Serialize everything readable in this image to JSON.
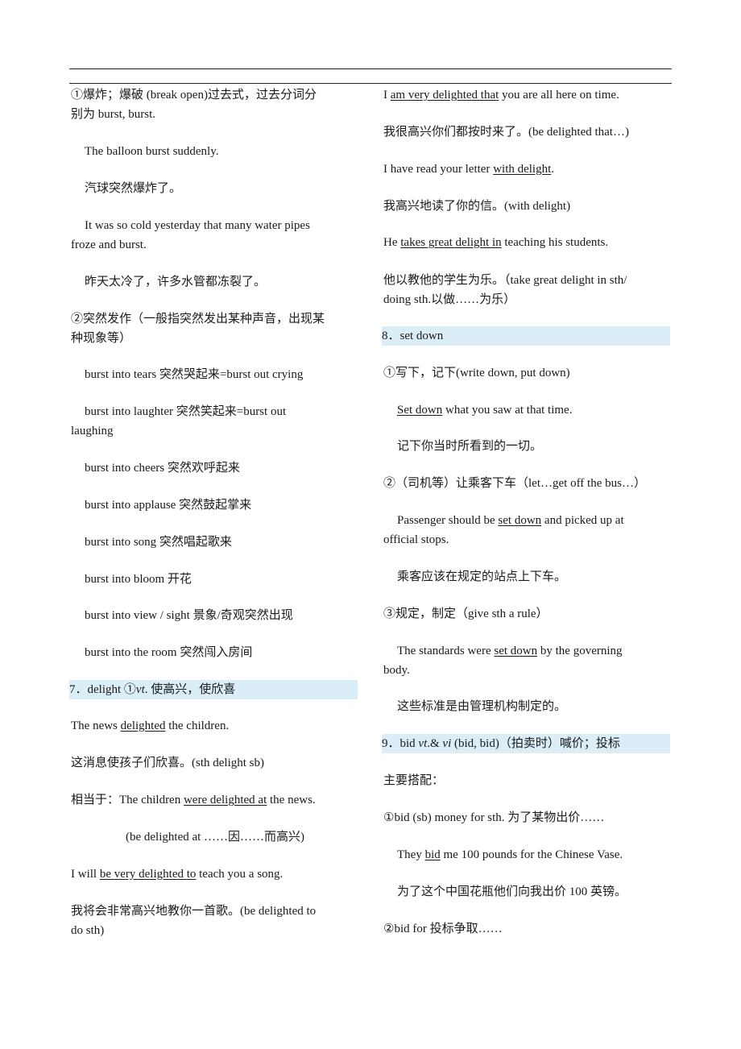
{
  "left_column": [
    {
      "style": "",
      "lines": [
        [
          {
            "t": "①爆炸；爆破  (break open)过去式，过去分词分"
          }
        ],
        [
          {
            "t": "别为  burst, burst."
          }
        ]
      ]
    },
    {
      "style": "indent",
      "lines": [
        [
          {
            "t": "The balloon burst suddenly."
          }
        ]
      ]
    },
    {
      "style": "indent",
      "lines": [
        [
          {
            "t": "汽球突然爆炸了。"
          }
        ]
      ]
    },
    {
      "style": "indent",
      "lines": [
        [
          {
            "t": "It was so cold yesterday that many water pipes"
          }
        ],
        [
          {
            "t": "froze and burst."
          }
        ]
      ]
    },
    {
      "style": "indent",
      "lines": [
        [
          {
            "t": "昨天太冷了，许多水管都冻裂了。"
          }
        ]
      ]
    },
    {
      "style": "",
      "lines": [
        [
          {
            "t": "②突然发作（一般指突然发出某种声音，出现某"
          }
        ],
        [
          {
            "t": "种现象等）"
          }
        ]
      ]
    },
    {
      "style": "indent",
      "lines": [
        [
          {
            "t": "burst into tears    突然哭起来=burst out crying"
          }
        ]
      ]
    },
    {
      "style": "indent",
      "lines": [
        [
          {
            "t": "burst into laughter    突然笑起来=burst out"
          }
        ],
        [
          {
            "t": "laughing"
          }
        ]
      ]
    },
    {
      "style": "indent",
      "lines": [
        [
          {
            "t": "burst into cheers    突然欢呼起来"
          }
        ]
      ]
    },
    {
      "style": "indent",
      "lines": [
        [
          {
            "t": "burst into applause    突然鼓起掌来"
          }
        ]
      ]
    },
    {
      "style": "indent",
      "lines": [
        [
          {
            "t": "burst into song    突然唱起歌来"
          }
        ]
      ]
    },
    {
      "style": "indent",
      "lines": [
        [
          {
            "t": "burst into bloom  开花"
          }
        ]
      ]
    },
    {
      "style": "indent",
      "lines": [
        [
          {
            "t": "burst into view / sight    景象/奇观突然出现"
          }
        ]
      ]
    },
    {
      "style": "indent",
      "lines": [
        [
          {
            "t": "burst into the room    突然闯入房间"
          }
        ]
      ]
    },
    {
      "style": "head",
      "lines": [
        [
          {
            "t": "7．delight  ①"
          },
          {
            "t": "vt",
            "s": "i"
          },
          {
            "t": ".  使高兴，使欣喜"
          }
        ]
      ]
    },
    {
      "style": "",
      "lines": [
        [
          {
            "t": "The news "
          },
          {
            "t": "delighted",
            "s": "u"
          },
          {
            "t": " the children."
          }
        ]
      ]
    },
    {
      "style": "",
      "lines": [
        [
          {
            "t": "这消息使孩子们欣喜。(sth delight sb)"
          }
        ]
      ]
    },
    {
      "style": "",
      "lines": [
        [
          {
            "t": "相当于：The children "
          },
          {
            "t": "were delighted at",
            "s": "u"
          },
          {
            "t": " the news."
          }
        ]
      ]
    },
    {
      "style": "deep",
      "lines": [
        [
          {
            "t": "(be delighted at ……因……而高兴)"
          }
        ]
      ]
    },
    {
      "style": "",
      "lines": [
        [
          {
            "t": "I will "
          },
          {
            "t": "be very delighted to",
            "s": "u"
          },
          {
            "t": " teach you a song."
          }
        ]
      ]
    },
    {
      "style": "",
      "lines": [
        [
          {
            "t": "我将会非常高兴地教你一首歌。(be delighted to"
          }
        ],
        [
          {
            "t": "do sth)"
          }
        ]
      ]
    }
  ],
  "right_column": [
    {
      "style": "",
      "lines": [
        [
          {
            "t": "I "
          },
          {
            "t": "am very delighted that",
            "s": "u"
          },
          {
            "t": " you are all here on time."
          }
        ]
      ]
    },
    {
      "style": "",
      "lines": [
        [
          {
            "t": "我很高兴你们都按时来了。(be delighted that…)"
          }
        ]
      ]
    },
    {
      "style": "",
      "lines": [
        [
          {
            "t": "I have read your letter "
          },
          {
            "t": "with delight",
            "s": "u"
          },
          {
            "t": "."
          }
        ]
      ]
    },
    {
      "style": "",
      "lines": [
        [
          {
            "t": "我高兴地读了你的信。(with delight)"
          }
        ]
      ]
    },
    {
      "style": "",
      "lines": [
        [
          {
            "t": "He "
          },
          {
            "t": "takes great delight in",
            "s": "u"
          },
          {
            "t": " teaching his students."
          }
        ]
      ]
    },
    {
      "style": "",
      "lines": [
        [
          {
            "t": "他以教他的学生为乐。（take great delight in sth/"
          }
        ],
        [
          {
            "t": "doing sth.以做……为乐）"
          }
        ]
      ]
    },
    {
      "style": "head",
      "lines": [
        [
          {
            "t": "8．set down"
          }
        ]
      ]
    },
    {
      "style": "",
      "lines": [
        [
          {
            "t": "①写下，记下(write down, put down)"
          }
        ]
      ]
    },
    {
      "style": "indent",
      "lines": [
        [
          {
            "t": "Set down",
            "s": "u"
          },
          {
            "t": " what you saw at that time."
          }
        ]
      ]
    },
    {
      "style": "indent",
      "lines": [
        [
          {
            "t": "记下你当时所看到的一切。"
          }
        ]
      ]
    },
    {
      "style": "",
      "lines": [
        [
          {
            "t": "②（司机等）让乘客下车（let…get off the bus…）"
          }
        ]
      ]
    },
    {
      "style": "indent",
      "lines": [
        [
          {
            "t": "Passenger should be "
          },
          {
            "t": "set down",
            "s": "u"
          },
          {
            "t": " and picked up at"
          }
        ],
        [
          {
            "t": "official stops."
          }
        ]
      ]
    },
    {
      "style": "indent",
      "lines": [
        [
          {
            "t": "乘客应该在规定的站点上下车。"
          }
        ]
      ]
    },
    {
      "style": "",
      "lines": [
        [
          {
            "t": "③规定，制定（give sth a rule）"
          }
        ]
      ]
    },
    {
      "style": "indent",
      "lines": [
        [
          {
            "t": "The standards were "
          },
          {
            "t": "set down",
            "s": "u"
          },
          {
            "t": " by the governing"
          }
        ],
        [
          {
            "t": "body."
          }
        ]
      ]
    },
    {
      "style": "indent",
      "lines": [
        [
          {
            "t": "这些标准是由管理机构制定的。"
          }
        ]
      ]
    },
    {
      "style": "head",
      "lines": [
        [
          {
            "t": "9．bid "
          },
          {
            "t": "vt",
            "s": "i"
          },
          {
            "t": ".& "
          },
          {
            "t": "vi",
            "s": "i"
          },
          {
            "t": " (bid, bid)（拍卖时）喊价；投标"
          }
        ]
      ]
    },
    {
      "style": "",
      "lines": [
        [
          {
            "t": "主要搭配："
          }
        ]
      ]
    },
    {
      "style": "",
      "lines": [
        [
          {
            "t": "①bid (sb) money for sth.  为了某物出价……"
          }
        ]
      ]
    },
    {
      "style": "indent",
      "lines": [
        [
          {
            "t": "They "
          },
          {
            "t": "bid",
            "s": "u"
          },
          {
            "t": " me 100 pounds for the Chinese Vase."
          }
        ]
      ]
    },
    {
      "style": "indent",
      "lines": [
        [
          {
            "t": "为了这个中国花瓶他们向我出价 100  英镑。"
          }
        ]
      ]
    },
    {
      "style": "",
      "lines": [
        [
          {
            "t": "②bid for  投标争取……"
          }
        ]
      ]
    }
  ]
}
